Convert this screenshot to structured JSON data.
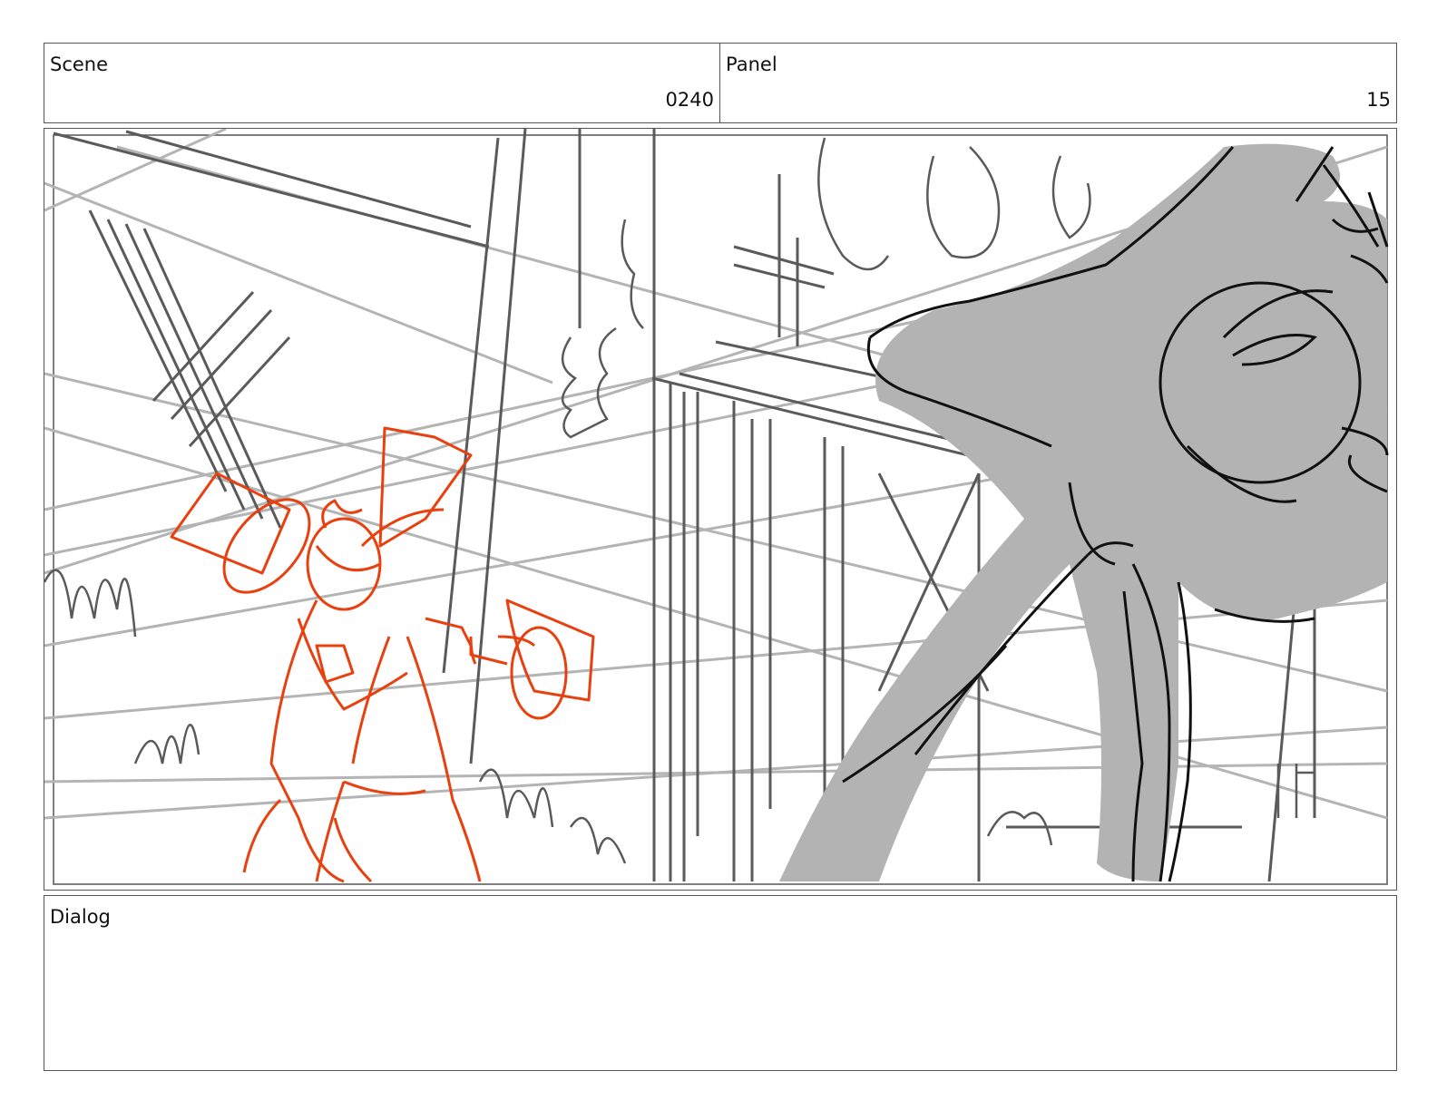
{
  "scene": {
    "label": "Scene",
    "value": "0240"
  },
  "panel": {
    "label": "Panel",
    "value": "15"
  },
  "dialog": {
    "label": "Dialog",
    "text": ""
  },
  "drawing": {
    "sketch_colors": {
      "background_lines": "#5a5a5a",
      "perspective_lines": "#b4b4b4",
      "character": "#e8400e",
      "silhouette_fill": "#b3b3b3",
      "silhouette_outline": "#111111"
    }
  }
}
